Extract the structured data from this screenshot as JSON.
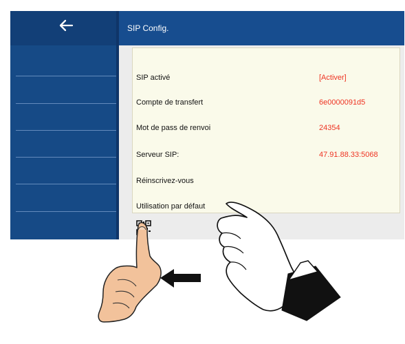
{
  "header": {
    "title": "SIP Config."
  },
  "sidebar": {
    "back_icon": "arrow-left-icon",
    "items": [
      "",
      "",
      "",
      "",
      "",
      "",
      ""
    ]
  },
  "settings": [
    {
      "label": "SIP activé",
      "value": "[Activer]"
    },
    {
      "label": "Compte de transfert",
      "value": "6e0000091d5"
    },
    {
      "label": "Mot de pass de renvoi",
      "value": "24354"
    },
    {
      "label": "Serveur SIP:",
      "value": "47.91.88.33:5068"
    },
    {
      "label": "Réinscrivez-vous",
      "value": ""
    },
    {
      "label": "Utilisation par défaut",
      "value": ""
    }
  ],
  "footer": {
    "qr_icon": "qr-code-icon"
  },
  "annotation": {
    "arrow": "left-arrow-icon",
    "hand_left": "pointing-hand-icon",
    "hand_right": "suited-pointing-hand-icon"
  },
  "colors": {
    "sidebar": "#164a86",
    "header": "#174d8f",
    "panel": "#fafaea",
    "value": "#ee3322"
  }
}
